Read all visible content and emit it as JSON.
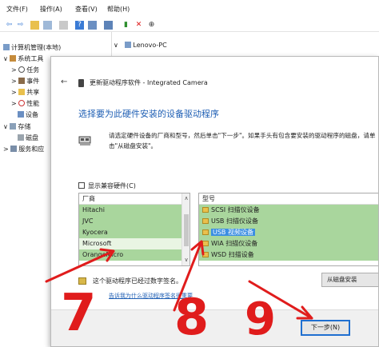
{
  "menu": [
    "文件(F)",
    "操作(A)",
    "查看(V)",
    "帮助(H)"
  ],
  "tree": {
    "root": "计算机管理(本地)",
    "items": [
      {
        "label": "系统工具",
        "expander": "∨"
      },
      {
        "label": "任务",
        "expander": ">"
      },
      {
        "label": "事件",
        "expander": ">"
      },
      {
        "label": "共享",
        "expander": ">"
      },
      {
        "label": "性能",
        "expander": ">"
      },
      {
        "label": "设备",
        "expander": ""
      },
      {
        "label": "存储",
        "expander": "∨"
      },
      {
        "label": "磁盘",
        "expander": ""
      },
      {
        "label": "服务和应",
        "expander": ">"
      }
    ]
  },
  "right_pane": {
    "node": "Lenovo-PC"
  },
  "dialog": {
    "back": "←",
    "title": "更新驱动程序软件 - Integrated Camera",
    "heading": "选择要为此硬件安装的设备驱动程序",
    "instructions": "请选定硬件设备的厂商和型号，然后单击\"下一步\"。如果手头有包含要安装的驱动程序的磁盘，请单击\"从磁盘安装\"。",
    "show_compatible": "显示兼容硬件(C)",
    "manufacturer_header": "厂商",
    "manufacturers": [
      "Hitachi",
      "JVC",
      "Kyocera",
      "Microsoft",
      "OrangeMicro"
    ],
    "selected_manufacturer": "Microsoft",
    "model_header": "型号",
    "models": [
      "SCSI 扫描仪设备",
      "USB 扫描仪设备",
      "USB 视频设备",
      "WIA 扫描仪设备",
      "WSD 扫描设备"
    ],
    "selected_model": "USB 视频设备",
    "signed_text": "这个驱动程序已经过数字签名。",
    "why_link": "告诉我为什么驱动程序签名很重要",
    "have_disk_button": "从磁盘安装",
    "next_button": "下一步(N)"
  },
  "annotations": {
    "step1": "7",
    "step2": "8",
    "step3": "9",
    "color": "#e01c1c"
  }
}
